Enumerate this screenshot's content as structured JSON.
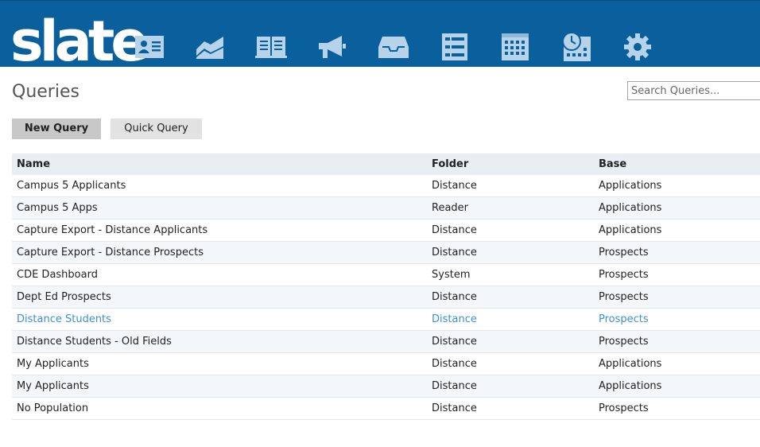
{
  "app": {
    "logo": "slate",
    "nav": [
      {
        "name": "records-icon"
      },
      {
        "name": "reports-icon"
      },
      {
        "name": "forms-icon"
      },
      {
        "name": "campaigns-icon"
      },
      {
        "name": "inbox-icon"
      },
      {
        "name": "list-icon"
      },
      {
        "name": "calendar-icon"
      },
      {
        "name": "schedule-icon"
      },
      {
        "name": "settings-icon"
      }
    ]
  },
  "page": {
    "title": "Queries",
    "search_placeholder": "Search Queries...",
    "buttons": {
      "new": "New Query",
      "quick": "Quick Query"
    }
  },
  "table": {
    "headers": {
      "name": "Name",
      "folder": "Folder",
      "base": "Base"
    },
    "rows": [
      {
        "name": "Campus 5 Applicants",
        "folder": "Distance",
        "base": "Applications"
      },
      {
        "name": "Campus 5 Apps",
        "folder": "Reader",
        "base": "Applications"
      },
      {
        "name": "Capture Export - Distance Applicants",
        "folder": "Distance",
        "base": "Applications"
      },
      {
        "name": "Capture Export - Distance Prospects",
        "folder": "Distance",
        "base": "Prospects"
      },
      {
        "name": "CDE Dashboard",
        "folder": "System",
        "base": "Prospects"
      },
      {
        "name": "Dept Ed Prospects",
        "folder": "Distance",
        "base": "Prospects"
      },
      {
        "name": "Distance Students",
        "folder": "Distance",
        "base": "Prospects"
      },
      {
        "name": "Distance Students - Old Fields",
        "folder": "Distance",
        "base": "Prospects"
      },
      {
        "name": "My Applicants",
        "folder": "Distance",
        "base": "Applications"
      },
      {
        "name": "My Applicants",
        "folder": "Distance",
        "base": "Applications"
      },
      {
        "name": "No Population",
        "folder": "Distance",
        "base": "Prospects"
      }
    ]
  },
  "colors": {
    "header_bar": "#0a609c",
    "icon": "#b7d3ea",
    "link": "#3d8fd6"
  }
}
